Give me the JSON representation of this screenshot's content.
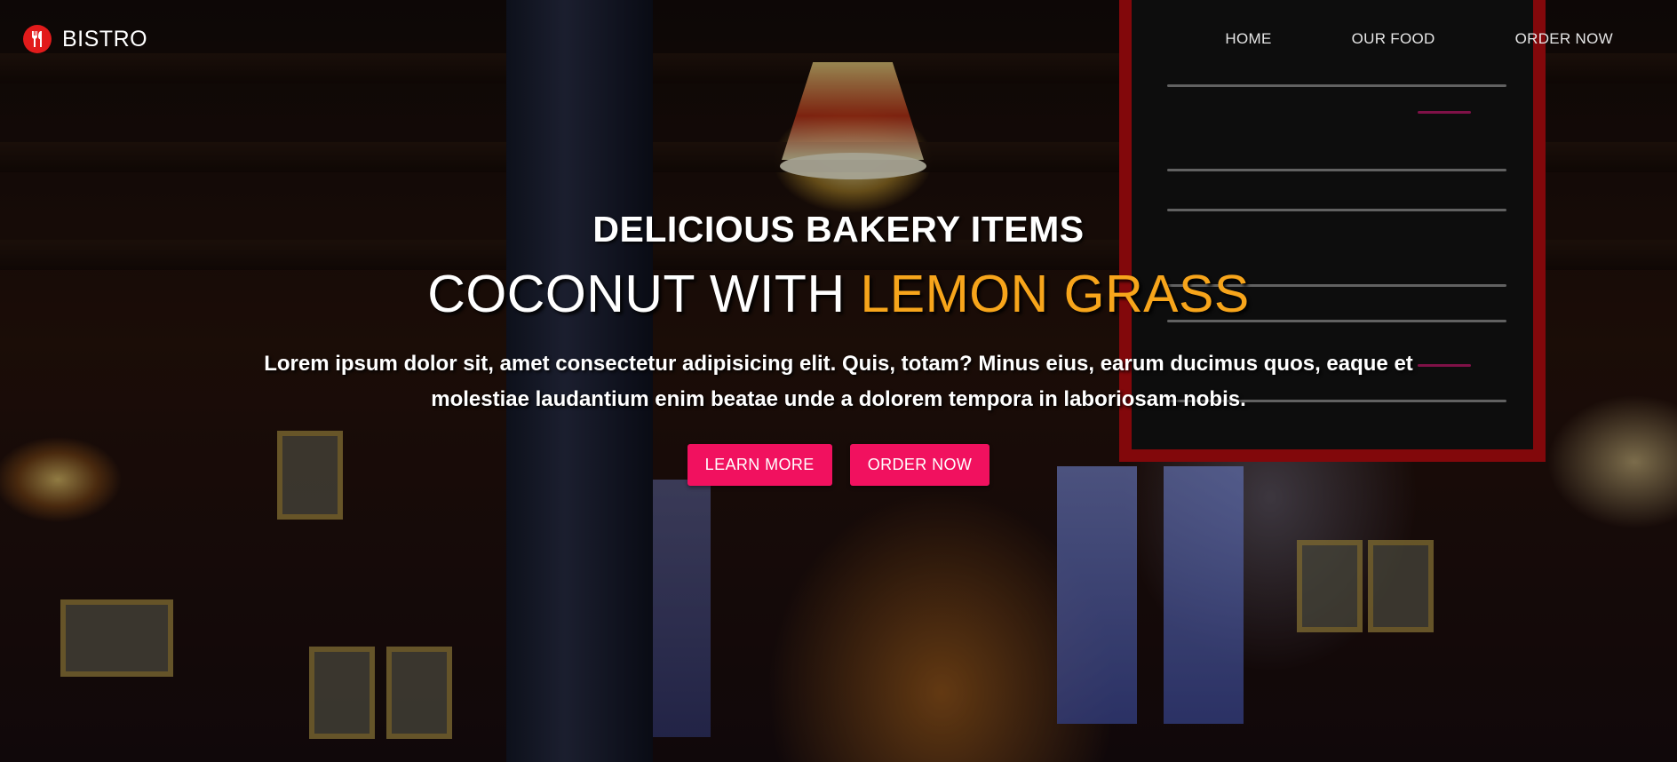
{
  "brand": {
    "name": "BISTRO",
    "icon": "fork-knife-icon",
    "icon_color": "#e21b1b"
  },
  "nav": {
    "items": [
      {
        "label": "HOME"
      },
      {
        "label": "OUR FOOD"
      },
      {
        "label": "ORDER NOW"
      }
    ]
  },
  "hero": {
    "subtitle": "DELICIOUS BAKERY ITEMS",
    "title_main": "COCONUT WITH ",
    "title_accent": "LEMON GRASS",
    "text": "Lorem ipsum dolor sit, amet consectetur adipisicing elit. Quis, totam? Minus eius, earum ducimus quos, eaque et molestiae laudantium enim beatae unde a dolorem tempora in laboriosam nobis.",
    "buttons": [
      {
        "label": "LEARN MORE"
      },
      {
        "label": "ORDER NOW"
      }
    ]
  },
  "colors": {
    "accent": "#f7a51b",
    "button": "#f1115f",
    "text": "#ffffff"
  }
}
